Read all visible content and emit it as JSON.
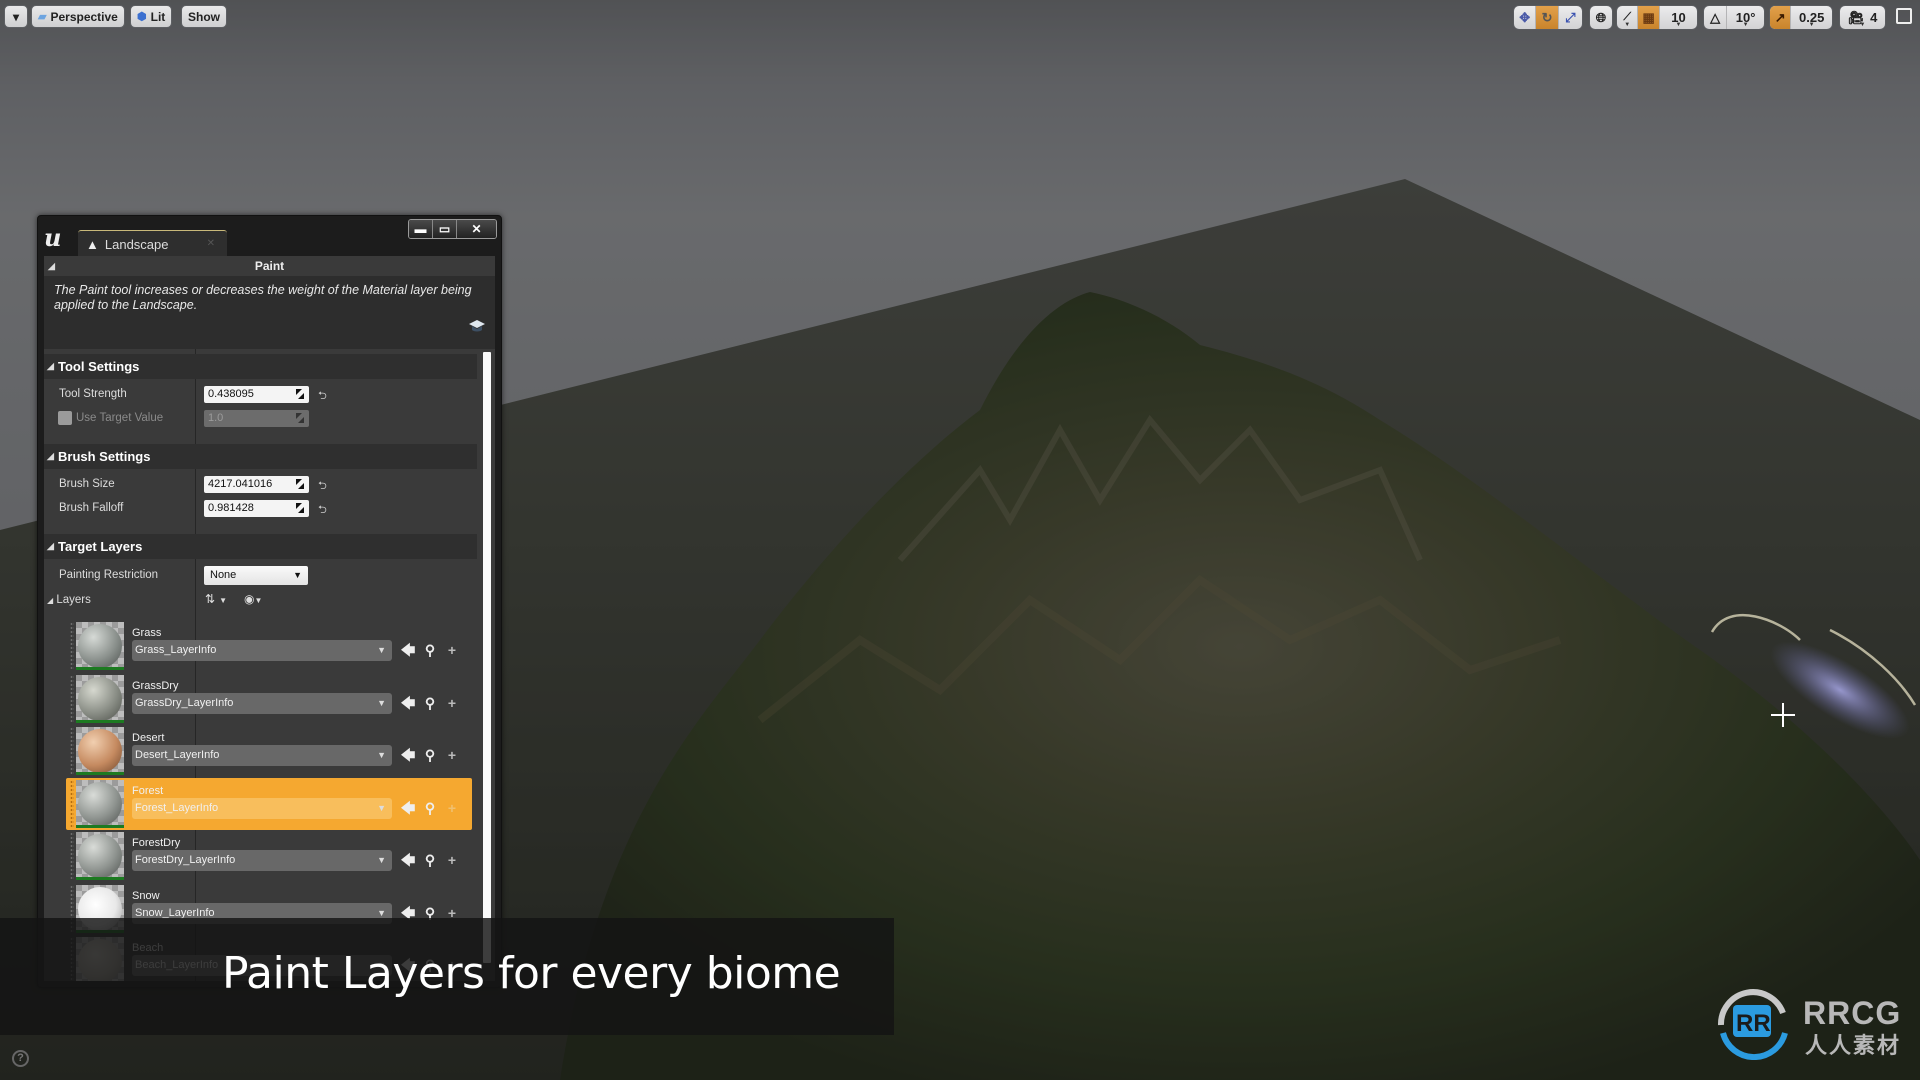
{
  "viewport_toolbar": {
    "menu_button": "▾",
    "perspective_label": "Perspective",
    "lit_label": "Lit",
    "show_label": "Show",
    "right_tools": {
      "grid_snap_value": "10",
      "rotation_snap_value": "10°",
      "scale_snap_value": "0.25",
      "camera_speed_value": "4"
    }
  },
  "panel": {
    "tab_label": "Landscape",
    "window_buttons": {
      "minimize": "▬",
      "maximize": "▭",
      "close": "✕"
    },
    "tool_header": "Paint",
    "description": "The Paint tool increases or decreases the weight of the Material layer being applied to the Landscape.",
    "sections": {
      "tool_settings": {
        "title": "Tool Settings",
        "tool_strength_label": "Tool Strength",
        "tool_strength_value": "0.438095",
        "use_target_value_label": "Use Target Value",
        "use_target_value_checked": false,
        "target_value": "1.0"
      },
      "brush_settings": {
        "title": "Brush Settings",
        "brush_size_label": "Brush Size",
        "brush_size_value": "4217.041016",
        "brush_falloff_label": "Brush Falloff",
        "brush_falloff_value": "0.981428"
      },
      "target_layers": {
        "title": "Target Layers",
        "painting_restriction_label": "Painting Restriction",
        "painting_restriction_value": "None",
        "layers_label": "Layers"
      }
    },
    "layers": [
      {
        "name": "Grass",
        "info": "Grass_LayerInfo",
        "selected": false
      },
      {
        "name": "GrassDry",
        "info": "GrassDry_LayerInfo",
        "selected": false
      },
      {
        "name": "Desert",
        "info": "Desert_LayerInfo",
        "selected": false
      },
      {
        "name": "Forest",
        "info": "Forest_LayerInfo",
        "selected": true
      },
      {
        "name": "ForestDry",
        "info": "ForestDry_LayerInfo",
        "selected": false
      },
      {
        "name": "Snow",
        "info": "Snow_LayerInfo",
        "selected": false
      },
      {
        "name": "Beach",
        "info": "Beach_LayerInfo",
        "selected": false
      }
    ]
  },
  "caption": "Paint Layers for every biome",
  "watermark": {
    "brand": "RRCG",
    "subtitle": "人人素材"
  },
  "colors": {
    "accent_orange": "#f5a830",
    "ue_active_toggle": "#d8933a",
    "watermark_blue": "#2b9be0"
  }
}
